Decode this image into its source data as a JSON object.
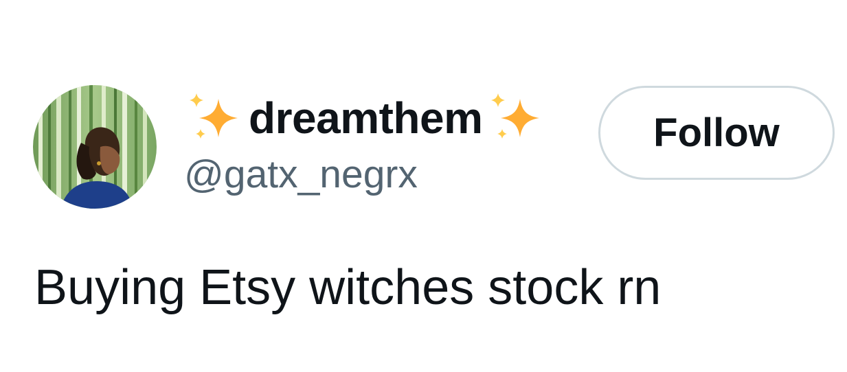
{
  "author": {
    "display_name": "dreamthem",
    "name_emoji": "sparkles",
    "handle": "@gatx_negrx",
    "avatar_icon": "profile-photo"
  },
  "follow_button": {
    "label": "Follow"
  },
  "tweet": {
    "text": "Buying Etsy witches stock rn"
  },
  "colors": {
    "text_primary": "#0f1419",
    "text_secondary": "#536471",
    "button_border": "#cfd9de",
    "sparkle": "#ffac33"
  }
}
